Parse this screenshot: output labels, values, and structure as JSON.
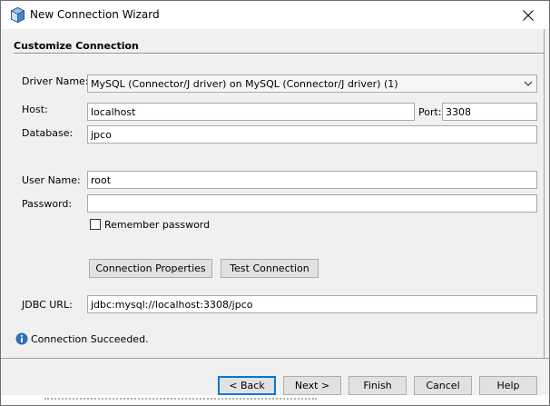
{
  "window": {
    "title": "New Connection Wizard",
    "icon": "netbeans-cube-icon",
    "close_icon": "close-icon"
  },
  "section": {
    "title": "Customize Connection"
  },
  "form": {
    "driver_label": "Driver Name:",
    "driver_value": "MySQL (Connector/J driver) on MySQL (Connector/J driver) (1)",
    "host_label": "Host:",
    "host_value": "localhost",
    "port_label": "Port:",
    "port_value": "3308",
    "database_label": "Database:",
    "database_value": "jpco",
    "username_label": "User Name:",
    "username_value": "root",
    "password_label": "Password:",
    "password_value": "",
    "remember_label": "Remember password",
    "remember_checked": false,
    "connection_properties_label": "Connection Properties",
    "test_connection_label": "Test Connection",
    "jdbc_label": "JDBC URL:",
    "jdbc_value": "jdbc:mysql://localhost:3308/jpco"
  },
  "status": {
    "icon": "info-icon",
    "text": "Connection Succeeded."
  },
  "buttons": {
    "back": "< Back",
    "next": "Next >",
    "finish": "Finish",
    "cancel": "Cancel",
    "help": "Help"
  },
  "colors": {
    "default_button_border": "#0078d7",
    "info_icon": "#2f6fb5",
    "dialog_background": "#f0f0f0"
  }
}
